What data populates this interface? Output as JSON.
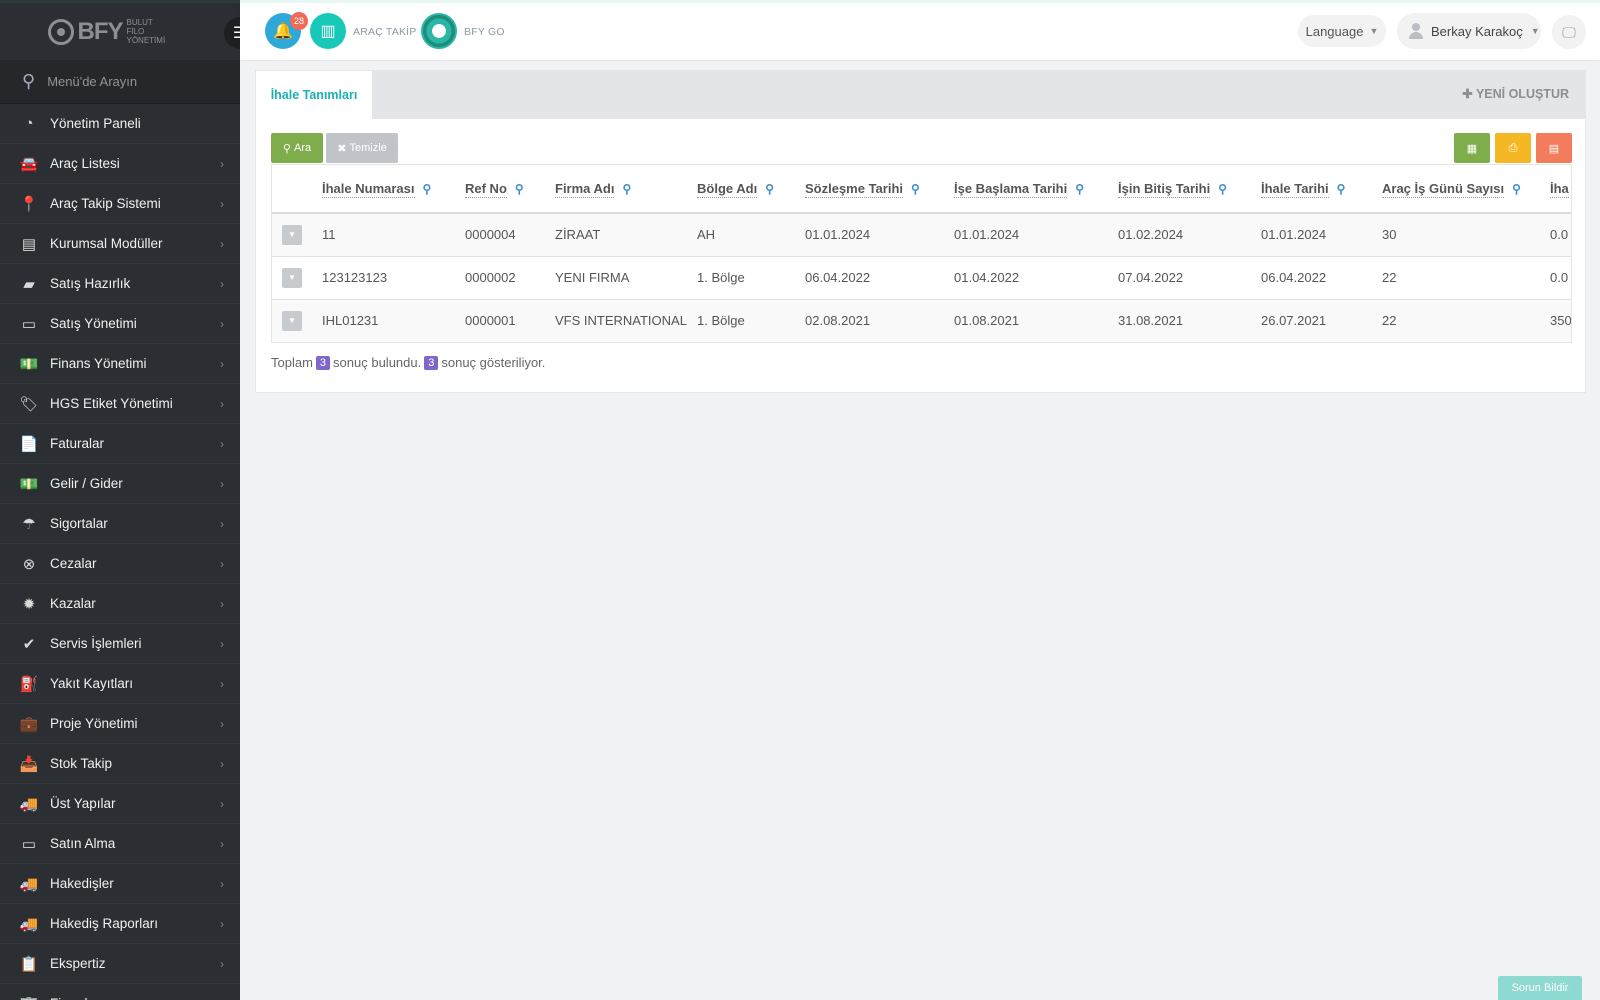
{
  "brand": {
    "name": "BFY",
    "subtitle": "BULUT FİLO YÖNETİMİ"
  },
  "sidebar": {
    "search_placeholder": "Menü'de Arayın",
    "items": [
      {
        "label": "Yönetim Paneli",
        "icon": "dashboard-icon",
        "glyph": "◔",
        "chevron": false
      },
      {
        "label": "Araç Listesi",
        "icon": "car-icon",
        "glyph": "🚘",
        "chevron": true
      },
      {
        "label": "Araç Takip Sistemi",
        "icon": "map-marker-icon",
        "glyph": "📍",
        "chevron": true
      },
      {
        "label": "Kurumsal Modüller",
        "icon": "server-icon",
        "glyph": "▤",
        "chevron": true
      },
      {
        "label": "Satış Hazırlık",
        "icon": "book-icon",
        "glyph": "▰",
        "chevron": true
      },
      {
        "label": "Satış Yönetimi",
        "icon": "credit-card-icon",
        "glyph": "▭",
        "chevron": true
      },
      {
        "label": "Finans Yönetimi",
        "icon": "money-icon",
        "glyph": "💵",
        "chevron": true
      },
      {
        "label": "HGS Etiket Yönetimi",
        "icon": "tags-icon",
        "glyph": "🏷",
        "chevron": true
      },
      {
        "label": "Faturalar",
        "icon": "file-icon",
        "glyph": "📄",
        "chevron": true
      },
      {
        "label": "Gelir / Gider",
        "icon": "money-bill-icon",
        "glyph": "💵",
        "chevron": true
      },
      {
        "label": "Sigortalar",
        "icon": "umbrella-icon",
        "glyph": "☂",
        "chevron": true
      },
      {
        "label": "Cezalar",
        "icon": "times-circle-icon",
        "glyph": "⊗",
        "chevron": true
      },
      {
        "label": "Kazalar",
        "icon": "car-crash-icon",
        "glyph": "✹",
        "chevron": true
      },
      {
        "label": "Servis İşlemleri",
        "icon": "check-circle-icon",
        "glyph": "✔",
        "chevron": true
      },
      {
        "label": "Yakıt Kayıtları",
        "icon": "gas-pump-icon",
        "glyph": "⛽",
        "chevron": true
      },
      {
        "label": "Proje Yönetimi",
        "icon": "briefcase-icon",
        "glyph": "💼",
        "chevron": true
      },
      {
        "label": "Stok Takip",
        "icon": "inbox-icon",
        "glyph": "📥",
        "chevron": true
      },
      {
        "label": "Üst Yapılar",
        "icon": "truck-icon",
        "glyph": "🚚",
        "chevron": true
      },
      {
        "label": "Satın Alma",
        "icon": "credit-card-icon",
        "glyph": "▭",
        "chevron": true
      },
      {
        "label": "Hakedişler",
        "icon": "truck-icon",
        "glyph": "🚚",
        "chevron": true
      },
      {
        "label": "Hakediş Raporları",
        "icon": "truck-icon",
        "glyph": "🚚",
        "chevron": true
      },
      {
        "label": "Ekspertiz",
        "icon": "list-alt-icon",
        "glyph": "📋",
        "chevron": true
      },
      {
        "label": "Firmalar",
        "icon": "building-icon",
        "glyph": "🏢",
        "chevron": true
      }
    ]
  },
  "topbar": {
    "notification_count": "28",
    "arac_takip_label": "ARAÇ TAKİP",
    "bfy_go_label": "BFY GO",
    "language_label": "Language",
    "user_name": "Berkay Karakoç"
  },
  "main": {
    "tab_label": "İhale Tanımları",
    "new_button_label": "YENİ OLUŞTUR",
    "search_button_label": "Ara",
    "clear_button_label": "Temizle",
    "columns": [
      "İhale Numarası",
      "Ref No",
      "Firma Adı",
      "Bölge Adı",
      "Sözleşme Tarihi",
      "İşe Başlama Tarihi",
      "İşin Bitiş Tarihi",
      "İhale Tarihi",
      "Araç İş Günü Sayısı",
      "İha"
    ],
    "rows": [
      {
        "ihale_no": "11",
        "ref_no": "0000004",
        "firma": "ZİRAAT",
        "bolge": "AH",
        "sozlesme": "01.01.2024",
        "baslama": "01.01.2024",
        "bitis": "01.02.2024",
        "ihale_tarihi": "01.01.2024",
        "is_gunu": "30",
        "son": "0.0"
      },
      {
        "ihale_no": "123123123",
        "ref_no": "0000002",
        "firma": "YENI FIRMA",
        "bolge": "1. Bölge",
        "sozlesme": "06.04.2022",
        "baslama": "01.04.2022",
        "bitis": "07.04.2022",
        "ihale_tarihi": "06.04.2022",
        "is_gunu": "22",
        "son": "0.0"
      },
      {
        "ihale_no": "IHL01231",
        "ref_no": "0000001",
        "firma": "VFS INTERNATIONAL",
        "bolge": "1. Bölge",
        "sozlesme": "02.08.2021",
        "baslama": "01.08.2021",
        "bitis": "31.08.2021",
        "ihale_tarihi": "26.07.2021",
        "is_gunu": "22",
        "son": "350"
      }
    ],
    "summary": {
      "prefix": "Toplam",
      "found_count": "3",
      "found_text": "sonuç bulundu.",
      "shown_count": "3",
      "shown_text": "sonuç gösteriliyor."
    }
  },
  "footer": {
    "report_button_label": "Sorun Bildir"
  },
  "colors": {
    "accent": "#1ab1b6",
    "sidebar_bg": "#2b2f33",
    "green": "#7fad4c",
    "yellow": "#f5b723",
    "orange": "#f27c5c",
    "badge": "#f06a5a",
    "pill": "#8166c9"
  }
}
